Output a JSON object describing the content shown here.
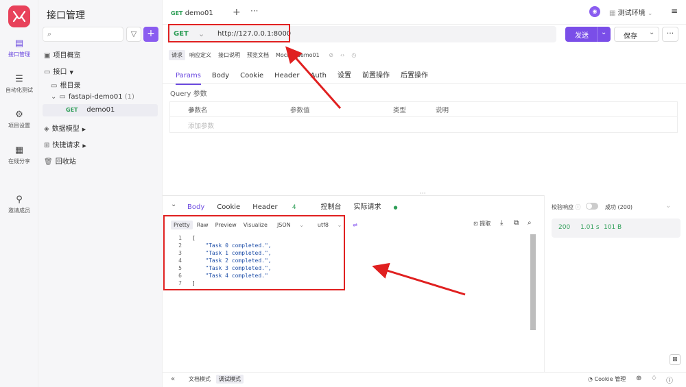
{
  "rail": {
    "items": [
      {
        "label": "接口管理"
      },
      {
        "label": "自动化测试"
      },
      {
        "label": "项目设置"
      },
      {
        "label": "在线分享"
      },
      {
        "label": "邀请成员"
      }
    ]
  },
  "sidebar": {
    "title": "接口管理",
    "items": [
      "项目概览",
      "接口",
      "根目录",
      "fastapi-demo01",
      "(1)",
      "demo01",
      "数据模型",
      "快捷请求",
      "回收站"
    ],
    "get_method": "GET"
  },
  "top": {
    "tab_method": "GET",
    "tab_label": "demo01",
    "env_label": "测试环境"
  },
  "request": {
    "method": "GET",
    "url": "http://127.0.0.1:8000",
    "send_label": "发送",
    "save_label": "保存"
  },
  "sub_tabs": [
    "请求",
    "响应定义",
    "接口说明",
    "预览文档",
    "Mock",
    "demo01"
  ],
  "req_tabs": [
    "Params",
    "Body",
    "Cookie",
    "Header",
    "Auth",
    "设置",
    "前置操作",
    "后置操作"
  ],
  "params": {
    "section_label": "Query 参数",
    "headers": [
      "参数名",
      "参数值",
      "类型",
      "说明"
    ],
    "add_placeholder": "添加参数"
  },
  "response": {
    "tabs": [
      "Body",
      "Cookie",
      "Header",
      "4",
      "控制台",
      "实际请求"
    ],
    "format_options": [
      "Pretty",
      "Raw",
      "Preview",
      "Visualize",
      "JSON",
      "utf8"
    ],
    "extract_label": "提取",
    "code_lines": [
      "[",
      "    \"Task 0 completed.\",",
      "    \"Task 1 completed.\",",
      "    \"Task 2 completed.\",",
      "    \"Task 3 completed.\",",
      "    \"Task 4 completed.\"",
      "]"
    ],
    "line_numbers": [
      "1",
      "2",
      "3",
      "4",
      "5",
      "6",
      "7"
    ]
  },
  "validate": {
    "label": "校验响应",
    "status_text": "成功 (200)",
    "code": "200",
    "time": "1.01 s",
    "size": "101 B"
  },
  "bottom": {
    "doc_mode": "文档模式",
    "debug_mode": "调试模式",
    "cookie_label": "Cookie 管理"
  },
  "colors": {
    "accent": "#7a4ee8",
    "get": "#2e9e57",
    "annotation": "#e02020",
    "brand": "#e8415a"
  }
}
